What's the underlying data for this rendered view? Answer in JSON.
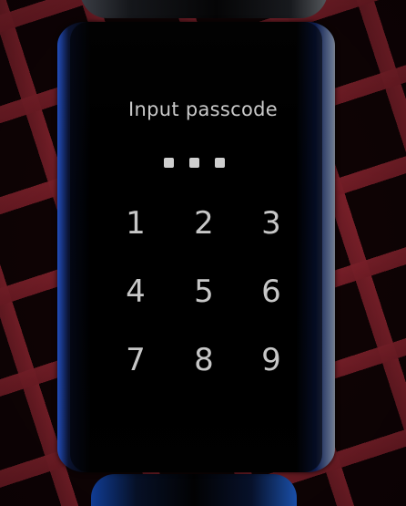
{
  "keypad": {
    "title": "Input passcode",
    "entered_count": 3,
    "keys": [
      "1",
      "2",
      "3",
      "4",
      "5",
      "6",
      "7",
      "8",
      "9"
    ]
  }
}
